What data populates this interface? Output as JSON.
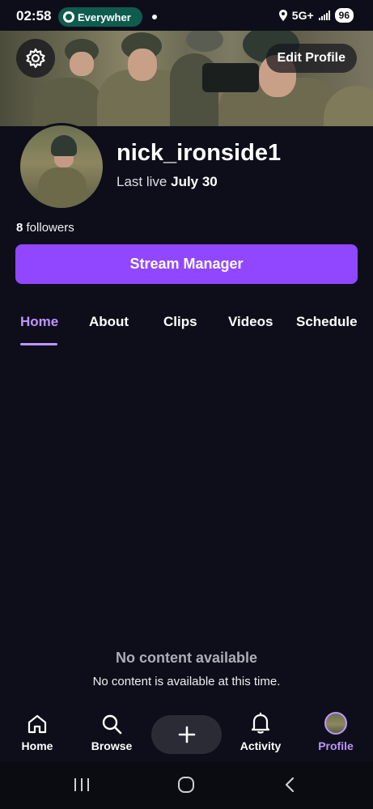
{
  "status_bar": {
    "time": "02:58",
    "pill_label": "Everywher",
    "network": "5G+",
    "battery": "96"
  },
  "header": {
    "edit_profile_label": "Edit Profile"
  },
  "profile": {
    "username": "nick_ironside1",
    "last_live_prefix": "Last live",
    "last_live_date": "July 30",
    "followers_count": "8",
    "followers_label": "followers",
    "stream_manager_label": "Stream Manager"
  },
  "tabs": [
    {
      "label": "Home",
      "active": true
    },
    {
      "label": "About"
    },
    {
      "label": "Clips"
    },
    {
      "label": "Videos"
    },
    {
      "label": "Schedule"
    }
  ],
  "empty_state": {
    "title": "No content available",
    "subtitle": "No content is available at this time."
  },
  "bottom_nav": [
    {
      "label": "Home",
      "icon": "home-icon"
    },
    {
      "label": "Browse",
      "icon": "search-icon"
    },
    {
      "label": "Activity",
      "icon": "bell-icon"
    },
    {
      "label": "Profile",
      "icon": "profile-avatar-icon",
      "active": true
    }
  ],
  "colors": {
    "accent": "#9147ff",
    "accent_text": "#bf94ff",
    "background": "#0e0e1a",
    "status_pill": "#0f5b4e"
  }
}
